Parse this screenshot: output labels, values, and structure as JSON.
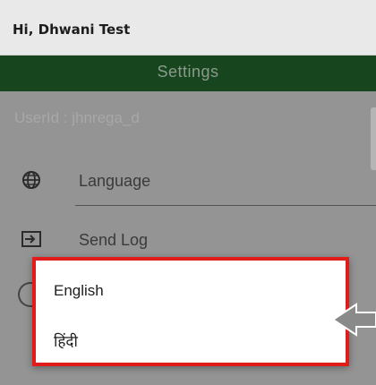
{
  "header": {
    "greeting": "Hi, Dhwani Test"
  },
  "settings": {
    "title": "Settings",
    "userid": "UserId : jhnrega_d",
    "items": [
      {
        "label": "Language",
        "icon": "globe-icon"
      },
      {
        "label": "Send Log",
        "icon": "send-log-icon"
      }
    ]
  },
  "language_dialog": {
    "options": [
      "English",
      "हिंदी"
    ]
  },
  "colors": {
    "header_green": "#17451d",
    "highlight_red": "#e21b1b",
    "callout_arrow": "#8a8a8a"
  }
}
